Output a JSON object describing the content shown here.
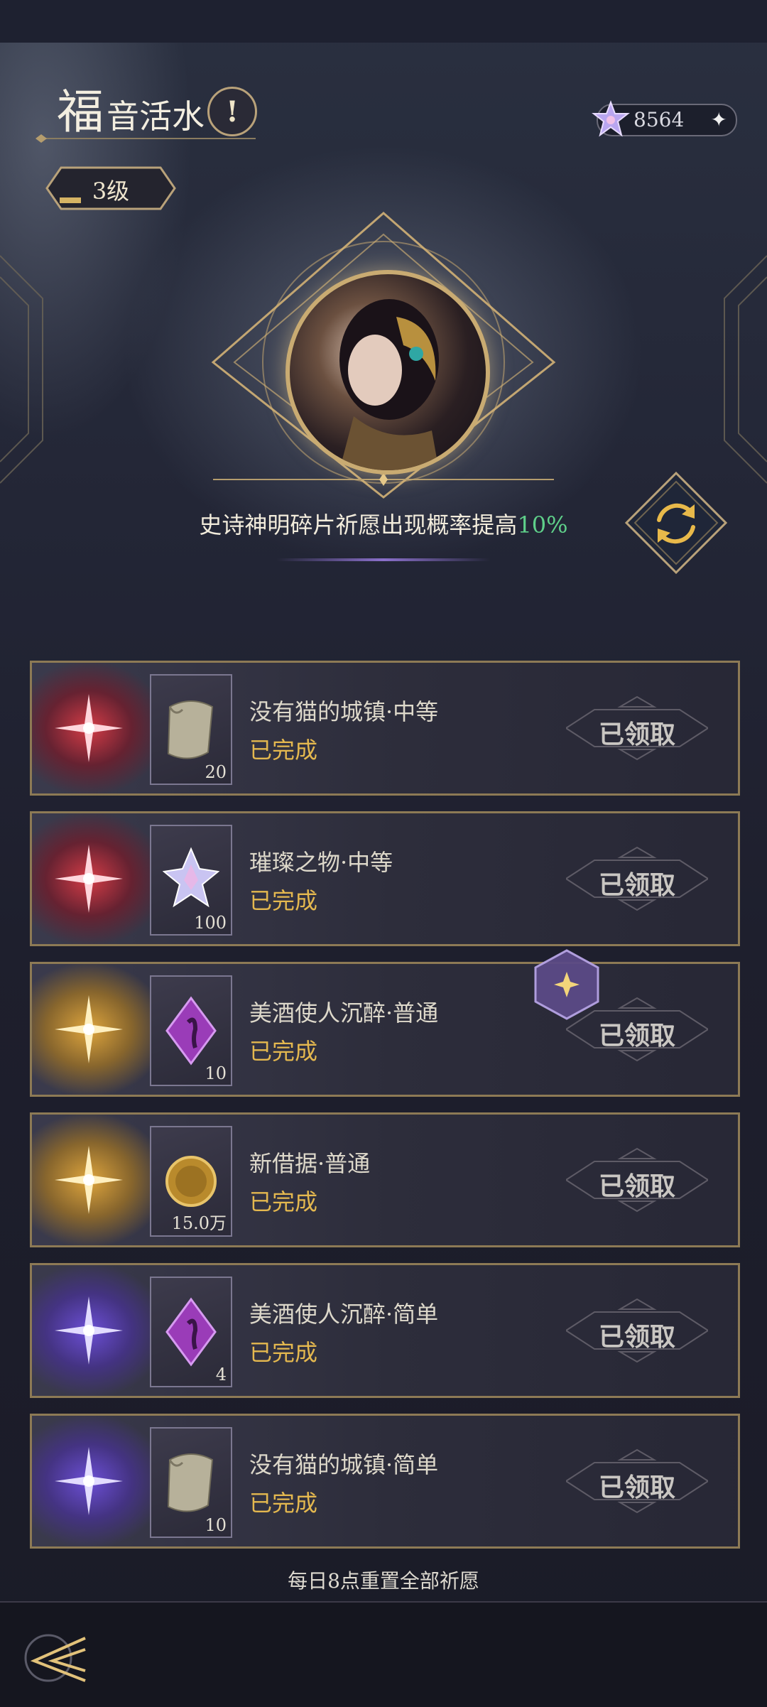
{
  "header": {
    "title_big": "福",
    "title_rest": "音活水",
    "info_icon": "!",
    "level": "3级",
    "currency": {
      "icon": "crystal-star-icon",
      "value": "8564",
      "plus": "✦"
    }
  },
  "bonus": {
    "prefix": "史诗神明碎片祈愿出现概率提高",
    "highlight": "10%"
  },
  "tasks": [
    {
      "rarity": "red",
      "item": "scroll",
      "qty": "20",
      "name": "没有猫的城镇·中等",
      "status": "已完成",
      "button": "已领取"
    },
    {
      "rarity": "red",
      "item": "crystal",
      "qty": "100",
      "name": "璀璨之物·中等",
      "status": "已完成",
      "button": "已领取"
    },
    {
      "rarity": "gold",
      "item": "shard",
      "qty": "10",
      "name": "美酒使人沉醉·普通",
      "status": "已完成",
      "button": "已领取"
    },
    {
      "rarity": "gold",
      "item": "coin",
      "qty": "15.0万",
      "name": "新借据·普通",
      "status": "已完成",
      "button": "已领取"
    },
    {
      "rarity": "purple",
      "item": "shard",
      "qty": "4",
      "name": "美酒使人沉醉·简单",
      "status": "已完成",
      "button": "已领取"
    },
    {
      "rarity": "purple",
      "item": "scroll",
      "qty": "10",
      "name": "没有猫的城镇·简单",
      "status": "已完成",
      "button": "已领取"
    }
  ],
  "footer": {
    "reset_note": "每日8点重置全部祈愿"
  },
  "colors": {
    "accent_gold": "#e4b84f",
    "highlight_green": "#5fd08a",
    "frame": "#8d7a55"
  }
}
